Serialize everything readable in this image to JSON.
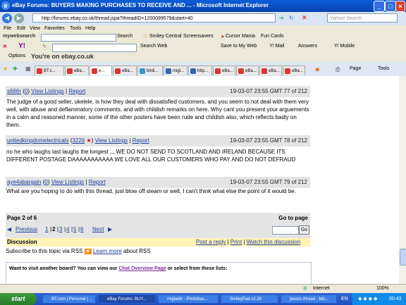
{
  "window": {
    "title": "eBay Forums: BUYERS MAKING PURCHASES TO RECEIVE AND ... - Microsoft Internet Explorer",
    "url": "http://forums.ebay.co.uk/thread.jspa?threadID=1200099579&start=40",
    "search_placeholder": "Yahoo! Search"
  },
  "menu": [
    "File",
    "Edit",
    "View",
    "Favorites",
    "Tools",
    "Help"
  ],
  "toolbar1": {
    "logo": "mywebsearch",
    "search": "Search",
    "smiley": "Smiley Central",
    "screensavers": "Screensavers",
    "cursor": "Cursor Mania",
    "funcards": "Fun Cards"
  },
  "toolbar2": {
    "search_web": "Search Web",
    "save": "Save to My Web",
    "mail": "Y! Mail",
    "answers": "Answers",
    "mobile": "Y! Mobile"
  },
  "toolbar3": {
    "options": "Options",
    "greeting": "You're on ebay.co.uk"
  },
  "tabs": [
    "BT.c...",
    "eBa...",
    "e...",
    "eBa...",
    "birdi...",
    "migl...",
    "http...",
    "eBa...",
    "eBa...",
    "eBa...",
    "eBa..."
  ],
  "tab_tools": {
    "page": "Page",
    "tools": "Tools"
  },
  "posts": [
    {
      "user": "s666r",
      "feedback": "0",
      "view": "View Listings",
      "report": "Report",
      "date": "19-03-07 23:55 GMT 77 of 212",
      "body": "The judge of a good seller, ukelele, is how they deal with dissatisfied customers, and you seem to not deal with them very well, with abuse and deflammatory comments, and with childish remarks on here. Why cant you present your arguements in a calm and reasoned manner, some of the other posters have been rude and childish also, which reflects badly on them."
    },
    {
      "user": "unitedkingdomelectricals",
      "feedback": "3226",
      "view": "View Listings",
      "report": "Report",
      "date": "19-03-07 23:55 GMT 78 of 212",
      "body": "no he who laughs last laughs the longest ,,, WE DO NOT SEND TO SCOTLAND AND IRELAND BECAUSE ITS DIFFERENT POSTAGE DAAAAAAAAAAA WE LOVE ALL OUR CUSTOMERS WHO PAY AND DO NOT DEFRAUD"
    },
    {
      "user": "aye4abargain",
      "feedback": "0",
      "view": "View Listings",
      "report": "Report",
      "date": "19-03-07 23:55 GMT 79 of 212",
      "body": "What are you hoping to do with this thread, just blow off steam or well, I can't think what else the point of it would be."
    }
  ],
  "pager": {
    "label": "Page 2 of 6",
    "goto": "Go to page",
    "previous": "Previous",
    "pages": [
      "1",
      "2",
      "3",
      "4",
      "5",
      "6"
    ],
    "next": "Next",
    "go": "Go"
  },
  "discussion": {
    "title": "Discussion",
    "post_reply": "Post a reply",
    "print": "Print",
    "watch": "Watch this discussion"
  },
  "subscribe": {
    "text": "Subscribe to this topic via RSS",
    "learn": "Learn more",
    "about": "about RSS"
  },
  "bottom": {
    "prefix": "Want to visit another board? You can view our",
    "link": "Chat Overview Page",
    "suffix": "or select from these lists:"
  },
  "statusbar": {
    "zone": "Internet",
    "zoom": "100%"
  },
  "taskbar": {
    "start": "start",
    "items": [
      "BT.com | Personal | ...",
      "eBay Forums: BUY...",
      "migladin - Photobuc...",
      "SmileyPad v2.28",
      "jasons thread - Mic..."
    ],
    "lang": "EN",
    "time": "00:43"
  }
}
